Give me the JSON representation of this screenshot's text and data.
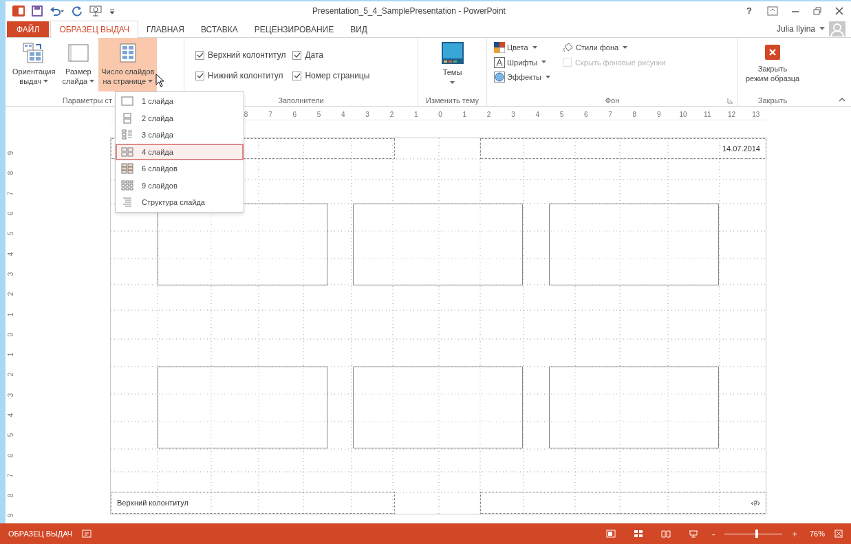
{
  "window": {
    "title": "Presentation_5_4_SamplePresentation - PowerPoint",
    "help": "?"
  },
  "user": {
    "name": "Julia Ilyina"
  },
  "tabs": [
    {
      "label": "ФАЙЛ",
      "kind": "file",
      "selected": false
    },
    {
      "label": "ОБРАЗЕЦ ВЫДАЧ",
      "kind": "tab",
      "selected": true
    },
    {
      "label": "ГЛАВНАЯ",
      "kind": "tab",
      "selected": false
    },
    {
      "label": "ВСТАВКА",
      "kind": "tab",
      "selected": false
    },
    {
      "label": "РЕЦЕНЗИРОВАНИЕ",
      "kind": "tab",
      "selected": false
    },
    {
      "label": "ВИД",
      "kind": "tab",
      "selected": false
    }
  ],
  "ribbon": {
    "page_setup": {
      "label": "Параметры ст",
      "buttons": [
        {
          "lines": [
            "Ориентация",
            "выдач"
          ],
          "kind": "orientation",
          "pressed": false
        },
        {
          "lines": [
            "Размер",
            "слайда"
          ],
          "kind": "size",
          "pressed": false
        },
        {
          "lines": [
            "Число слайдов",
            "на странице"
          ],
          "kind": "per-page",
          "pressed": true
        }
      ]
    },
    "placeholders": {
      "label": "Заполнители",
      "checkboxes": [
        {
          "label": "Верхний колонтитул",
          "checked": true
        },
        {
          "label": "Дата",
          "checked": true
        },
        {
          "label": "Нижний колонтитул",
          "checked": true
        },
        {
          "label": "Номер страницы",
          "checked": true
        }
      ]
    },
    "theme": {
      "label": "Изменить тему",
      "button": "Темы"
    },
    "background": {
      "label": "Фон",
      "items": [
        {
          "label": "Цвета",
          "kind": "colors"
        },
        {
          "label": "Шрифты",
          "kind": "fonts"
        },
        {
          "label": "Эффекты",
          "kind": "effects"
        }
      ],
      "styles": "Стили фона",
      "hide": {
        "label": "Скрыть фоновые рисунки",
        "checked": false,
        "disabled": true
      }
    },
    "close": {
      "label": "Закрыть",
      "button": [
        "Закрыть",
        "режим образца"
      ]
    }
  },
  "menu": [
    {
      "label": "1 слайда",
      "kind": "one",
      "selected": false
    },
    {
      "label": "2 слайда",
      "kind": "two",
      "selected": false
    },
    {
      "label": "3 слайда",
      "kind": "three",
      "selected": false
    },
    {
      "label": "4 слайда",
      "kind": "four",
      "selected": true
    },
    {
      "label": "6 слайдов",
      "kind": "six",
      "selected": false
    },
    {
      "label": "9 слайдов",
      "kind": "nine",
      "selected": false
    },
    {
      "label": "Структура слайда",
      "kind": "outline",
      "selected": false
    }
  ],
  "ruler_h": [
    "8",
    "7",
    "6",
    "5",
    "4",
    "3",
    "2",
    "1",
    "0",
    "1",
    "2",
    "3",
    "4",
    "5",
    "6",
    "7",
    "8",
    "9",
    "10",
    "11",
    "12",
    "13"
  ],
  "ruler_v": [
    "9",
    "8",
    "7",
    "6",
    "5",
    "4",
    "3",
    "2",
    "1",
    "0",
    "1",
    "2",
    "3",
    "4",
    "5",
    "6",
    "7",
    "8",
    "9"
  ],
  "handout": {
    "date": "14.07.2014",
    "footer": "Верхний колонтитул",
    "page_number": "‹#›"
  },
  "status_bar": {
    "mode": "ОБРАЗЕЦ ВЫДАЧ",
    "zoom_out": "-",
    "zoom_in": "+",
    "zoom": "76%",
    "level": 0.55
  }
}
